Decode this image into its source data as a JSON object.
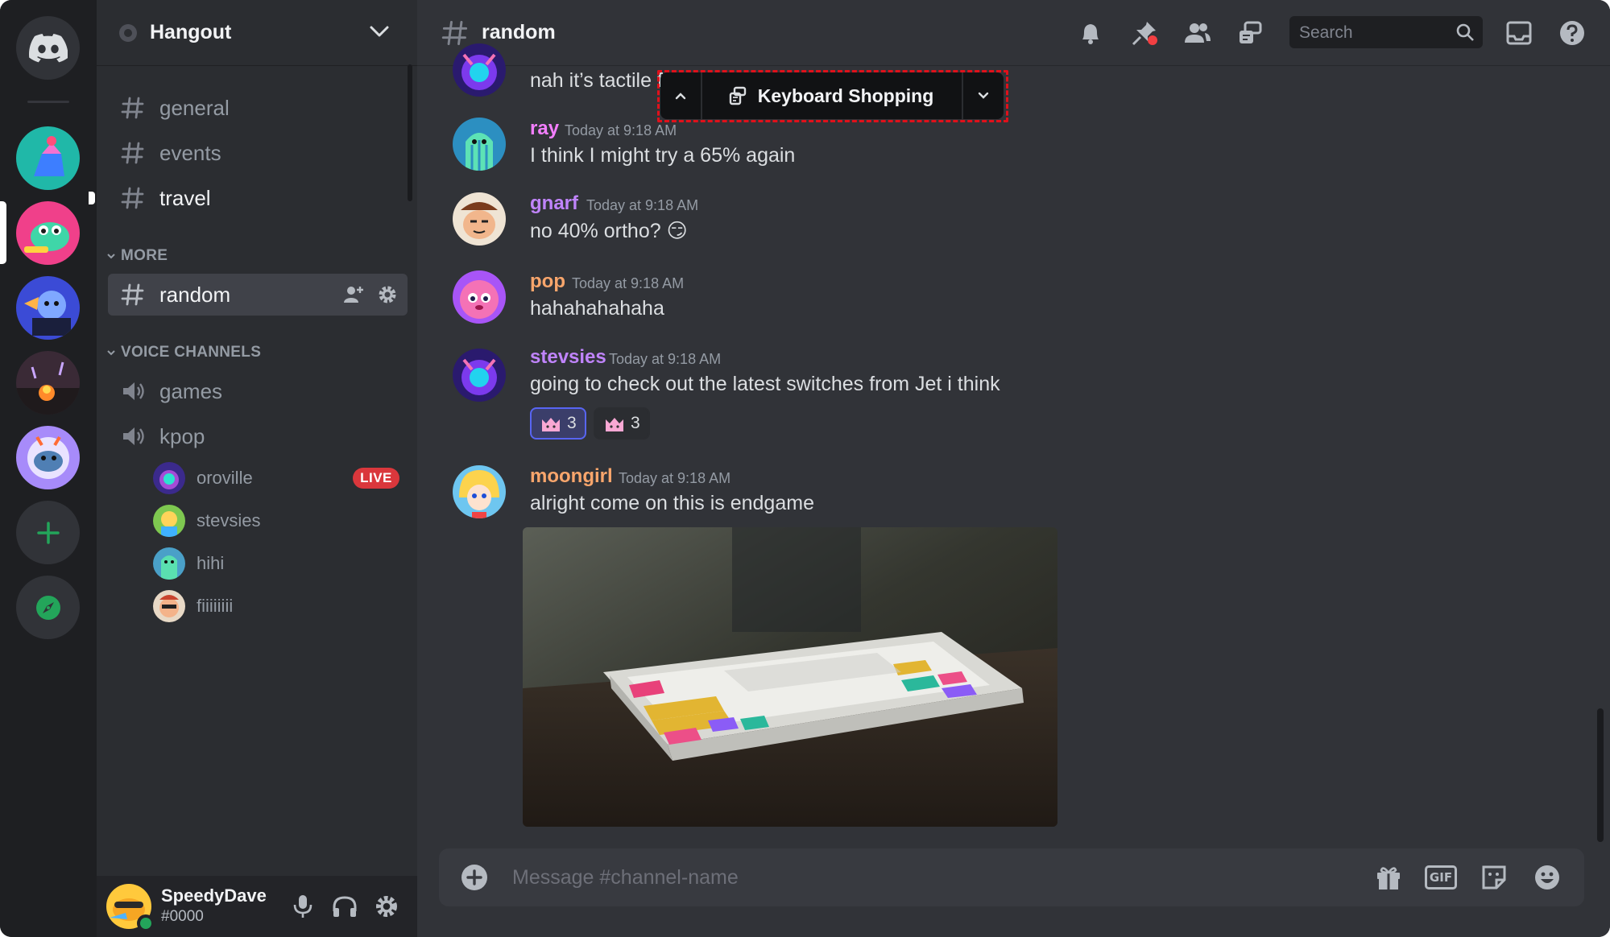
{
  "guild": {
    "name": "Hangout"
  },
  "channels": {
    "text": [
      {
        "name": "general"
      },
      {
        "name": "events"
      },
      {
        "name": "travel"
      }
    ],
    "more_category": "MORE",
    "selected": {
      "name": "random"
    },
    "voice_category": "VOICE CHANNELS",
    "voice": [
      {
        "name": "games"
      },
      {
        "name": "kpop"
      }
    ],
    "voice_members": [
      {
        "name": "oroville",
        "badge": "LIVE"
      },
      {
        "name": "stevsies"
      },
      {
        "name": "hihi"
      },
      {
        "name": "fiiiiiiii"
      }
    ]
  },
  "user": {
    "name": "SpeedyDave",
    "tag": "#0000"
  },
  "header": {
    "channel": "random",
    "search_placeholder": "Search"
  },
  "thread_bar": {
    "label": "Keyboard Shopping"
  },
  "messages": [
    {
      "author": "",
      "timestamp": "",
      "text": "nah it’s tactile for"
    },
    {
      "author": "ray",
      "timestamp": "Today at 9:18 AM",
      "text": "I think I might try a 65% again",
      "color": "#f47fff"
    },
    {
      "author": "gnarf",
      "timestamp": "Today at 9:18 AM",
      "text": "no 40% ortho? 😏",
      "color": "#c084fc"
    },
    {
      "author": "pop",
      "timestamp": "Today at 9:18 AM",
      "text": "hahahahahaha",
      "color": "#f9a66c"
    },
    {
      "author": "stevsies",
      "timestamp": "Today at 9:18 AM",
      "text": "going to check out the latest switches from Jet i think",
      "color": "#c084fc",
      "reactions": [
        {
          "count": "3",
          "me": true
        },
        {
          "count": "3",
          "me": false
        }
      ]
    },
    {
      "author": "moongirl",
      "timestamp": "Today at 9:18 AM",
      "text": "alright come on this is endgame",
      "color": "#f9a66c"
    }
  ],
  "composer": {
    "placeholder": "Message #channel-name",
    "gif_label": "GIF"
  },
  "colors": {
    "accent": "#5865f2",
    "live": "#da373c",
    "online": "#23a55a",
    "highlight": "#e0101a"
  },
  "icons": [
    "discord-logo-icon",
    "hash-icon",
    "speaker-icon",
    "bell-icon",
    "pin-icon",
    "members-icon",
    "threads-icon",
    "search-icon",
    "inbox-icon",
    "help-icon",
    "mic-icon",
    "headphones-icon",
    "gear-icon",
    "add-member-icon",
    "plus-icon",
    "gift-icon",
    "gif-icon",
    "sticker-icon",
    "emoji-icon",
    "compass-icon",
    "chevron-up-icon",
    "chevron-down-icon"
  ]
}
